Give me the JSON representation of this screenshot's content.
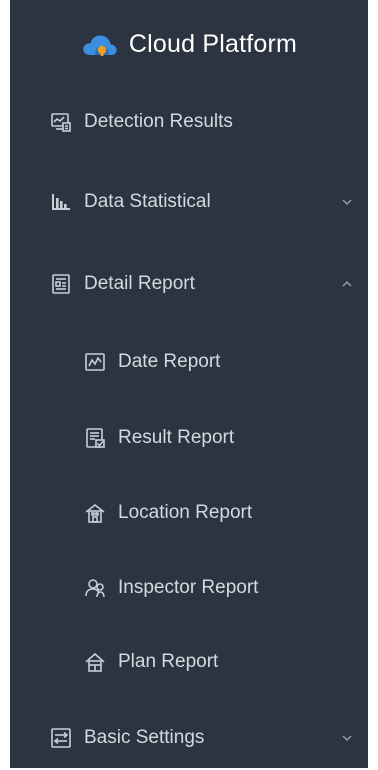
{
  "brand": {
    "title": "Cloud Platform",
    "logo_icon": "cloud-logo-icon"
  },
  "menu": {
    "detection_results": {
      "label": "Detection Results",
      "icon": "monitor-chart-icon"
    },
    "data_statistical": {
      "label": "Data Statistical",
      "icon": "bar-chart-icon",
      "expanded": false
    },
    "detail_report": {
      "label": "Detail Report",
      "icon": "report-icon",
      "expanded": true,
      "children": {
        "date_report": {
          "label": "Date Report",
          "icon": "line-chart-icon"
        },
        "result_report": {
          "label": "Result Report",
          "icon": "document-icon"
        },
        "location_report": {
          "label": "Location Report",
          "icon": "building-icon"
        },
        "inspector_report": {
          "label": "Inspector Report",
          "icon": "users-icon"
        },
        "plan_report": {
          "label": "Plan Report",
          "icon": "house-icon"
        }
      }
    },
    "basic_settings": {
      "label": "Basic Settings",
      "icon": "settings-sliders-icon",
      "expanded": false
    }
  },
  "colors": {
    "sidebar_bg": "#2b3440",
    "text": "#d4d9df",
    "brand_text": "#ffffff",
    "logo_blue": "#3c8fe0",
    "logo_orange": "#f0a020"
  }
}
